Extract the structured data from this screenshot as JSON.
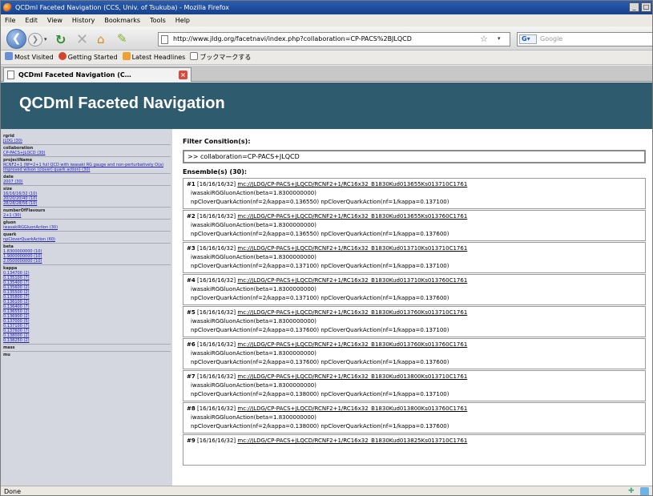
{
  "window": {
    "title": "QCDml Faceted Navigation (CCS, Univ. of Tsukuba) - Mozilla Firefox"
  },
  "menu": [
    "File",
    "Edit",
    "View",
    "History",
    "Bookmarks",
    "Tools",
    "Help"
  ],
  "nav": {
    "url": "http://www.jldg.org/facetnavi/index.php?collaboration=CP-PACS%2BJLQCD",
    "search_placeholder": "Google"
  },
  "bookmarks": [
    "Most Visited",
    "Getting Started",
    "Latest Headlines",
    "ブックマークする"
  ],
  "tab": {
    "label": "QCDml Faceted Navigation (C…"
  },
  "page": {
    "title": "QCDml Faceted Navigation"
  },
  "facets": [
    {
      "name": "rgrid",
      "values": [
        "JLDG (30)"
      ]
    },
    {
      "name": "collaboration",
      "values": [
        "CP-PACS+JLQCD (30)"
      ]
    },
    {
      "name": "projectName",
      "values": [
        "RCNF2+1 (Nf=2+1 full QCD with iwasaki RG gauge and non-perturbatively O(a) improved wilson (clover) quark action) (30)"
      ]
    },
    {
      "name": "date",
      "values": [
        "2007 (30)"
      ]
    },
    {
      "name": "size",
      "values": [
        "16/16/16/32 (10)",
        "20/20/20/40 (10)",
        "28/28/28/56 (10)"
      ]
    },
    {
      "name": "numberOfFlavours",
      "values": [
        "2+1 (30)"
      ]
    },
    {
      "name": "gluon",
      "values": [
        "iwasakiRGGluonAction (30)"
      ]
    },
    {
      "name": "quark",
      "values": [
        "npCloverQuarkAction (60)"
      ]
    },
    {
      "name": "beta",
      "values": [
        "1.8300000000 (10)",
        "1.9000000000 (10)",
        "2.0500000000 (10)"
      ]
    },
    {
      "name": "kappa",
      "values": [
        "0.134700 (2)",
        "0.135100 (7)",
        "0.135400 (7)",
        "0.135600 (2)",
        "0.135500 (2)",
        "0.135800 (7)",
        "0.136100 (2)",
        "0.136400 (7)",
        "0.136550 (2)",
        "0.136900 (2)",
        "0.137000 (5)",
        "0.137100 (7)",
        "0.137600 (7)",
        "0.138000 (2)",
        "0.138250 (2)"
      ]
    },
    {
      "name": "mass",
      "values": []
    },
    {
      "name": "mu",
      "values": []
    }
  ],
  "filter": {
    "label": "Filter Consition(s):",
    "value": ">> collaboration=CP-PACS+JLQCD"
  },
  "ensembles_label": "Ensemble(s) (30):",
  "ensembles": [
    {
      "num": "#1",
      "size": "[16/16/16/32]",
      "uri": "mc://JLDG/CP-PACS+JLQCD/RCNF2+1/RC16x32_B1830Kud013655Ks013710C1761",
      "gluon": "iwasakiRGGluonAction(beta=1.8300000000)",
      "quark": "npCloverQuarkAction(nf=2/kappa=0.136550) npCloverQuarkAction(nf=1/kappa=0.137100)"
    },
    {
      "num": "#2",
      "size": "[16/16/16/32]",
      "uri": "mc://JLDG/CP-PACS+JLQCD/RCNF2+1/RC16x32_B1830Kud013655Ks013760C1761",
      "gluon": "iwasakiRGGluonAction(beta=1.8300000000)",
      "quark": "npCloverQuarkAction(nf=2/kappa=0.136550) npCloverQuarkAction(nf=1/kappa=0.137600)"
    },
    {
      "num": "#3",
      "size": "[16/16/16/32]",
      "uri": "mc://JLDG/CP-PACS+JLQCD/RCNF2+1/RC16x32_B1830Kud013710Ks013710C1761",
      "gluon": "iwasakiRGGluonAction(beta=1.8300000000)",
      "quark": "npCloverQuarkAction(nf=2/kappa=0.137100) npCloverQuarkAction(nf=1/kappa=0.137100)"
    },
    {
      "num": "#4",
      "size": "[16/16/16/32]",
      "uri": "mc://JLDG/CP-PACS+JLQCD/RCNF2+1/RC16x32_B1830Kud013710Ks013760C1761",
      "gluon": "iwasakiRGGluonAction(beta=1.8300000000)",
      "quark": "npCloverQuarkAction(nf=2/kappa=0.137100) npCloverQuarkAction(nf=1/kappa=0.137600)"
    },
    {
      "num": "#5",
      "size": "[16/16/16/32]",
      "uri": "mc://JLDG/CP-PACS+JLQCD/RCNF2+1/RC16x32_B1830Kud013760Ks013710C1761",
      "gluon": "iwasakiRGGluonAction(beta=1.8300000000)",
      "quark": "npCloverQuarkAction(nf=2/kappa=0.137600) npCloverQuarkAction(nf=1/kappa=0.137100)"
    },
    {
      "num": "#6",
      "size": "[16/16/16/32]",
      "uri": "mc://JLDG/CP-PACS+JLQCD/RCNF2+1/RC16x32_B1830Kud013760Ks013760C1761",
      "gluon": "iwasakiRGGluonAction(beta=1.8300000000)",
      "quark": "npCloverQuarkAction(nf=2/kappa=0.137600) npCloverQuarkAction(nf=1/kappa=0.137600)"
    },
    {
      "num": "#7",
      "size": "[16/16/16/32]",
      "uri": "mc://JLDG/CP-PACS+JLQCD/RCNF2+1/RC16x32_B1830Kud013800Ks013710C1761",
      "gluon": "iwasakiRGGluonAction(beta=1.8300000000)",
      "quark": "npCloverQuarkAction(nf=2/kappa=0.138000) npCloverQuarkAction(nf=1/kappa=0.137100)"
    },
    {
      "num": "#8",
      "size": "[16/16/16/32]",
      "uri": "mc://JLDG/CP-PACS+JLQCD/RCNF2+1/RC16x32_B1830Kud013800Ks013760C1761",
      "gluon": "iwasakiRGGluonAction(beta=1.8300000000)",
      "quark": "npCloverQuarkAction(nf=2/kappa=0.138000) npCloverQuarkAction(nf=1/kappa=0.137600)"
    },
    {
      "num": "#9",
      "size": "[16/16/16/32]",
      "uri": "mc://JLDG/CP-PACS+JLQCD/RCNF2+1/RC16x32_B1830Kud013825Ks013710C1761",
      "gluon": "",
      "quark": ""
    }
  ],
  "status": {
    "text": "Done"
  }
}
